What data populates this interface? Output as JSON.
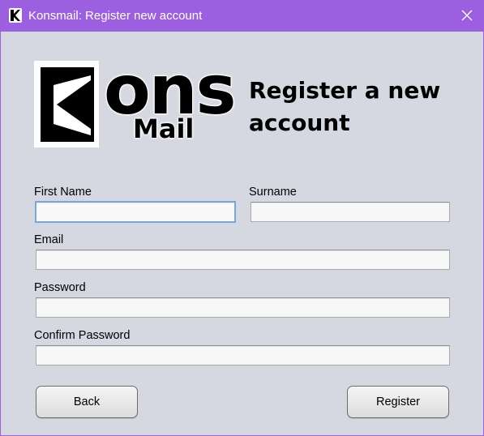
{
  "window": {
    "title": "Konsmail: Register new account",
    "title_bar_color": "#9b5fe0",
    "icon": "konsmail-k-icon",
    "close_icon": "close-icon"
  },
  "logo": {
    "text_top": "ons",
    "text_bottom": "Mail",
    "icon": "konsmail-k-logo"
  },
  "heading": "Register a new account",
  "form": {
    "first_name": {
      "label": "First Name",
      "value": ""
    },
    "surname": {
      "label": "Surname",
      "value": ""
    },
    "email": {
      "label": "Email",
      "value": ""
    },
    "password": {
      "label": "Password",
      "value": ""
    },
    "confirm_password": {
      "label": "Confirm Password",
      "value": ""
    }
  },
  "buttons": {
    "back": "Back",
    "register": "Register"
  }
}
